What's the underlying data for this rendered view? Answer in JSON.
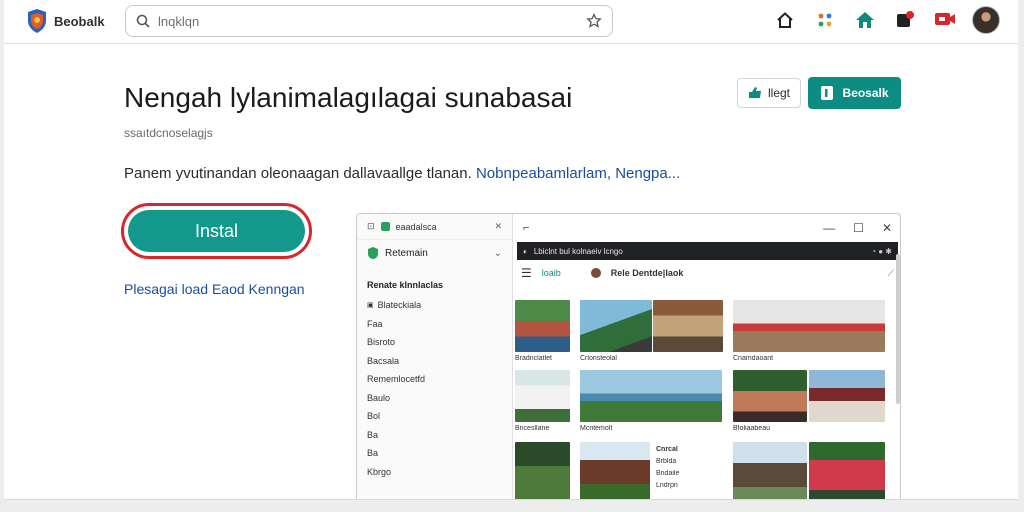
{
  "topbar": {
    "brand_name": "Beobalk",
    "search_placeholder": "lnqklqn",
    "icons": [
      "home-icon",
      "apps-icon",
      "house-icon",
      "notification-icon",
      "screen-icon",
      "avatar"
    ]
  },
  "main": {
    "title": "Nengah lylanimalagılagai sunabasai",
    "subtitle": "ssaıtdcnoselagjs",
    "description": "Panem yvutinandan oleonaagan dallavaallge tlanan.",
    "description_link": "Nobnpeabamlarlam, Nengpa...",
    "save_label": "llegt",
    "feedback_label": "Beosalk",
    "install_label": "Instal",
    "more_link": "Plesagai load Eaod Kenngan"
  },
  "preview": {
    "sidebar_tab": "eaadalsca",
    "sidebar_head": "Retemain",
    "section_title": "Renate klnnlaclas",
    "sidebar_items": [
      "Blateckiala",
      "Faa",
      "Bisroto",
      "Bacsala",
      "Rememlocetfd",
      "Baulo",
      "Bol",
      "Ba",
      "Ba",
      "Kbrgo"
    ],
    "address_text": "Lbiclnt bul kolnaeiv lcngo",
    "appbar_label": "loaib",
    "appbar_title": "Rele Dentde|laok",
    "captions": [
      "Bradnclatlet",
      "Crlonsteolal",
      "Cnamdaoant",
      "Bncesllane",
      "Mcntemolt",
      "Bfoliaabeau",
      "Cnrcal",
      "Brblda",
      "Bndaile",
      "Lndrpn"
    ],
    "colors": {
      "accent": "#13988c",
      "highlight": "#d8262a",
      "link": "#1a4e9c"
    }
  }
}
